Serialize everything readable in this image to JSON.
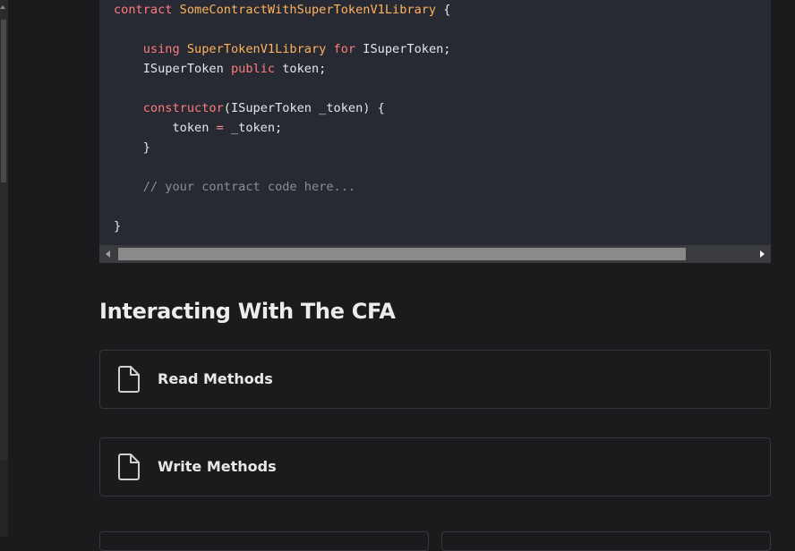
{
  "code": {
    "lines": [
      [
        {
          "t": "contract ",
          "c": "kw"
        },
        {
          "t": "SomeContractWithSuperTokenV1Library",
          "c": "ty"
        },
        {
          "t": " {"
        }
      ],
      [],
      [
        {
          "t": "    "
        },
        {
          "t": "using ",
          "c": "kw"
        },
        {
          "t": "SuperTokenV1Library",
          "c": "ty"
        },
        {
          "t": " for ",
          "c": "kw"
        },
        {
          "t": "ISuperToken;"
        }
      ],
      [
        {
          "t": "    ISuperToken "
        },
        {
          "t": "public",
          "c": "kw"
        },
        {
          "t": " token;"
        }
      ],
      [],
      [
        {
          "t": "    "
        },
        {
          "t": "constructor",
          "c": "kw"
        },
        {
          "t": "(ISuperToken _token) {"
        }
      ],
      [
        {
          "t": "        token "
        },
        {
          "t": "=",
          "c": "op"
        },
        {
          "t": " _token;"
        }
      ],
      [
        {
          "t": "    }"
        }
      ],
      [],
      [
        {
          "t": "    "
        },
        {
          "t": "// your contract code here...",
          "c": "cm"
        }
      ],
      [],
      [
        {
          "t": "}"
        }
      ]
    ]
  },
  "section": {
    "title": "Interacting With The CFA"
  },
  "cards": [
    {
      "label": "Read Methods",
      "icon": "file-icon"
    },
    {
      "label": "Write Methods",
      "icon": "file-icon"
    }
  ]
}
